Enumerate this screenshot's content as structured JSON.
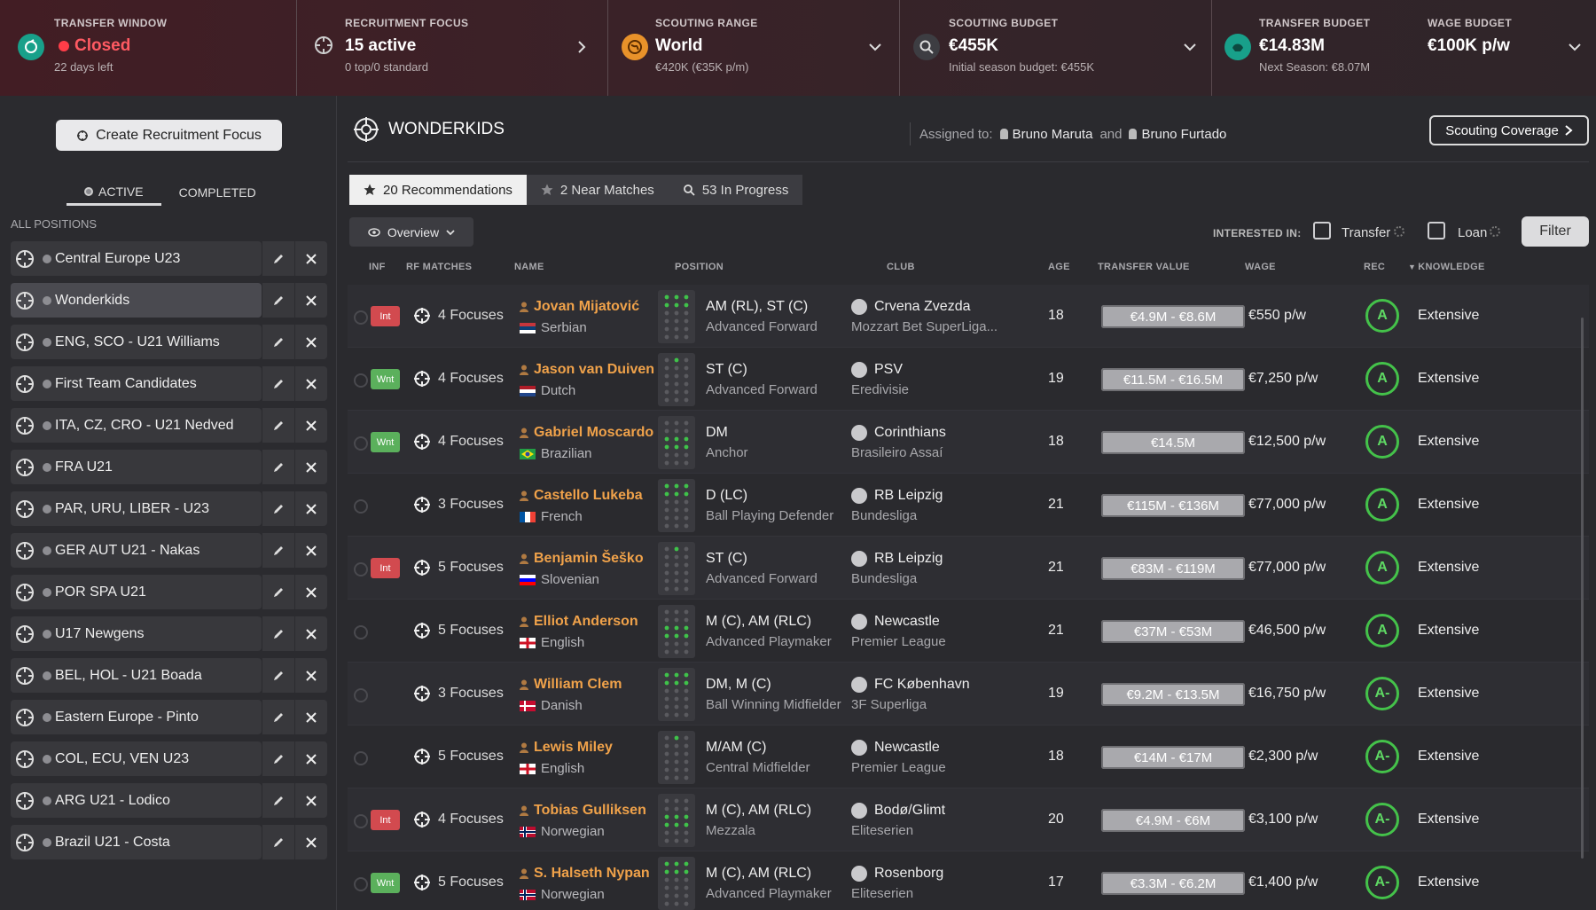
{
  "topbar": {
    "transfer_window": {
      "label": "TRANSFER WINDOW",
      "status": "Closed",
      "sub": "22 days left"
    },
    "recruitment_focus": {
      "label": "RECRUITMENT FOCUS",
      "value": "15 active",
      "sub": "0 top/0 standard"
    },
    "scouting_range": {
      "label": "SCOUTING RANGE",
      "value": "World",
      "sub": "€420K (€35K p/m)"
    },
    "scouting_budget": {
      "label": "SCOUTING BUDGET",
      "value": "€455K",
      "sub": "Initial season budget: €455K"
    },
    "transfer_budget": {
      "label": "TRANSFER BUDGET",
      "value": "€14.83M",
      "sub": "Next Season: €8.07M"
    },
    "wage_budget": {
      "label": "WAGE BUDGET",
      "value": "€100K p/w"
    }
  },
  "sidebar": {
    "create_label": "Create Recruitment Focus",
    "tabs": [
      "ACTIVE",
      "COMPLETED"
    ],
    "all_positions": "ALL POSITIONS",
    "items": [
      "Central Europe U23",
      "Wonderkids",
      "ENG, SCO - U21 Williams",
      "First Team Candidates",
      "ITA, CZ, CRO - U21 Nedved",
      "FRA U21",
      "PAR, URU, LIBER - U23",
      "GER AUT U21 - Nakas",
      "POR SPA U21",
      "U17 Newgens",
      "BEL, HOL - U21 Boada",
      "Eastern Europe - Pinto",
      "COL, ECU, VEN U23",
      "ARG U21 - Lodico",
      "Brazil U21 - Costa"
    ]
  },
  "main": {
    "title": "WONDERKIDS",
    "assigned_label": "Assigned to:",
    "scout1": "Bruno Maruta",
    "and": "and",
    "scout2": "Bruno Furtado",
    "coverage_label": "Scouting Coverage",
    "tabs": {
      "recommendations": "20 Recommendations",
      "near": "2 Near Matches",
      "progress": "53 In Progress"
    },
    "overview_label": "Overview",
    "interested_in": "INTERESTED IN:",
    "transfer_label": "Transfer",
    "loan_label": "Loan",
    "filter_label": "Filter",
    "headers": {
      "inf": "INF",
      "rf": "RF MATCHES",
      "name": "NAME",
      "position": "POSITION",
      "club": "CLUB",
      "age": "AGE",
      "tv": "TRANSFER VALUE",
      "wage": "WAGE",
      "rec": "REC",
      "knowledge": "KNOWLEDGE"
    }
  },
  "players": [
    {
      "inf": "Int",
      "rf": "4 Focuses",
      "name": "Jovan Mijatović",
      "nat": "Serbian",
      "flag": "rs",
      "pos": "AM (RL), ST (C)",
      "role": "Advanced Forward",
      "club": "Crvena Zvezda",
      "league": "Mozzart Bet SuperLiga...",
      "age": "18",
      "tv": "€4.9M - €8.6M",
      "wage": "€550 p/w",
      "rec": "A",
      "know": "Extensive"
    },
    {
      "inf": "Wnt",
      "rf": "4 Focuses",
      "name": "Jason van Duiven",
      "nat": "Dutch",
      "flag": "nl",
      "pos": "ST (C)",
      "role": "Advanced Forward",
      "club": "PSV",
      "league": "Eredivisie",
      "age": "19",
      "tv": "€11.5M - €16.5M",
      "wage": "€7,250 p/w",
      "rec": "A",
      "know": "Extensive"
    },
    {
      "inf": "Wnt",
      "rf": "4 Focuses",
      "name": "Gabriel Moscardo",
      "nat": "Brazilian",
      "flag": "br",
      "pos": "DM",
      "role": "Anchor",
      "club": "Corinthians",
      "league": "Brasileiro Assaí",
      "age": "18",
      "tv": "€14.5M",
      "wage": "€12,500 p/w",
      "rec": "A",
      "know": "Extensive"
    },
    {
      "inf": "",
      "rf": "3 Focuses",
      "name": "Castello Lukeba",
      "nat": "French",
      "flag": "fr",
      "pos": "D (LC)",
      "role": "Ball Playing Defender",
      "club": "RB Leipzig",
      "league": "Bundesliga",
      "age": "21",
      "tv": "€115M - €136M",
      "wage": "€77,000 p/w",
      "rec": "A",
      "know": "Extensive"
    },
    {
      "inf": "Int",
      "rf": "5 Focuses",
      "name": "Benjamin Šeško",
      "nat": "Slovenian",
      "flag": "si",
      "pos": "ST (C)",
      "role": "Advanced Forward",
      "club": "RB Leipzig",
      "league": "Bundesliga",
      "age": "21",
      "tv": "€83M - €119M",
      "wage": "€77,000 p/w",
      "rec": "A",
      "know": "Extensive"
    },
    {
      "inf": "",
      "rf": "5 Focuses",
      "name": "Elliot Anderson",
      "nat": "English",
      "flag": "en",
      "pos": "M (C), AM (RLC)",
      "role": "Advanced Playmaker",
      "club": "Newcastle",
      "league": "Premier League",
      "age": "21",
      "tv": "€37M - €53M",
      "wage": "€46,500 p/w",
      "rec": "A",
      "know": "Extensive"
    },
    {
      "inf": "",
      "rf": "3 Focuses",
      "name": "William Clem",
      "nat": "Danish",
      "flag": "dk",
      "pos": "DM, M (C)",
      "role": "Ball Winning Midfielder",
      "club": "FC København",
      "league": "3F Superliga",
      "age": "19",
      "tv": "€9.2M - €13.5M",
      "wage": "€16,750 p/w",
      "rec": "A-",
      "know": "Extensive"
    },
    {
      "inf": "",
      "rf": "5 Focuses",
      "name": "Lewis Miley",
      "nat": "English",
      "flag": "en",
      "pos": "M/AM (C)",
      "role": "Central Midfielder",
      "club": "Newcastle",
      "league": "Premier League",
      "age": "18",
      "tv": "€14M - €17M",
      "wage": "€2,300 p/w",
      "rec": "A-",
      "know": "Extensive"
    },
    {
      "inf": "Int",
      "rf": "4 Focuses",
      "name": "Tobias Gulliksen",
      "nat": "Norwegian",
      "flag": "no",
      "pos": "M (C), AM (RLC)",
      "role": "Mezzala",
      "club": "Bodø/Glimt",
      "league": "Eliteserien",
      "age": "20",
      "tv": "€4.9M - €6M",
      "wage": "€3,100 p/w",
      "rec": "A-",
      "know": "Extensive"
    },
    {
      "inf": "Wnt",
      "rf": "5 Focuses",
      "name": "S. Halseth Nypan",
      "nat": "Norwegian",
      "flag": "no",
      "pos": "M (C), AM (RLC)",
      "role": "Advanced Playmaker",
      "club": "Rosenborg",
      "league": "Eliteserien",
      "age": "17",
      "tv": "€3.3M - €6.2M",
      "wage": "€1,400 p/w",
      "rec": "A-",
      "know": "Extensive"
    }
  ]
}
